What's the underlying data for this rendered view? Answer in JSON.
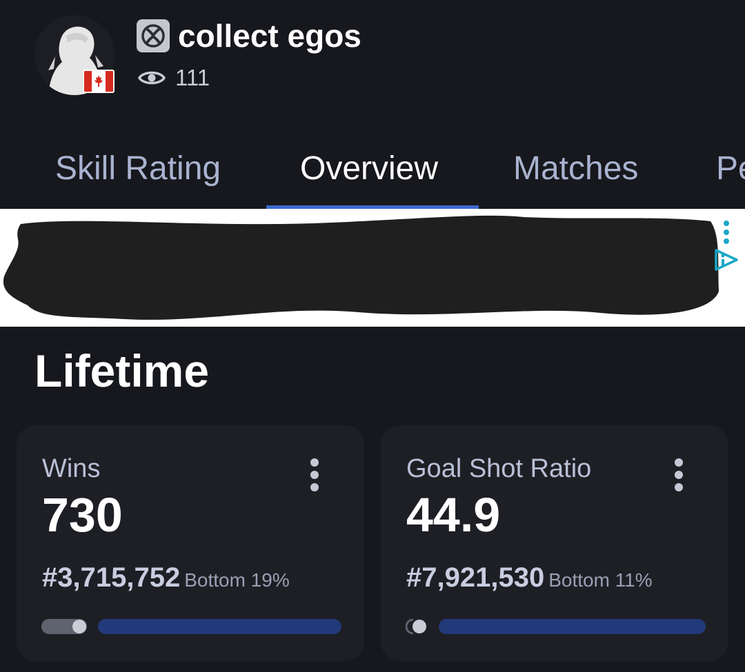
{
  "profile": {
    "username": "collect egos",
    "views": "111",
    "platform_icon": "xbox-icon",
    "country_flag": "canada-flag-icon"
  },
  "tabs": [
    {
      "label": "Skill Rating",
      "active": false
    },
    {
      "label": "Overview",
      "active": true
    },
    {
      "label": "Matches",
      "active": false
    },
    {
      "label": "Pe",
      "active": false
    }
  ],
  "section": {
    "title": "Lifetime"
  },
  "stats": [
    {
      "label": "Wins",
      "value": "730",
      "rank": "#3,715,752",
      "percentile": "Bottom 19%",
      "percentile_fraction": 0.19
    },
    {
      "label": "Goal Shot Ratio",
      "value": "44.9",
      "rank": "#7,921,530",
      "percentile": "Bottom 11%",
      "percentile_fraction": 0.11
    }
  ],
  "colors": {
    "background": "#17181d",
    "card": "#1e1f25",
    "accent": "#3d6ad1",
    "bar": "#223a7a",
    "tab_inactive": "#a9b3d0"
  }
}
